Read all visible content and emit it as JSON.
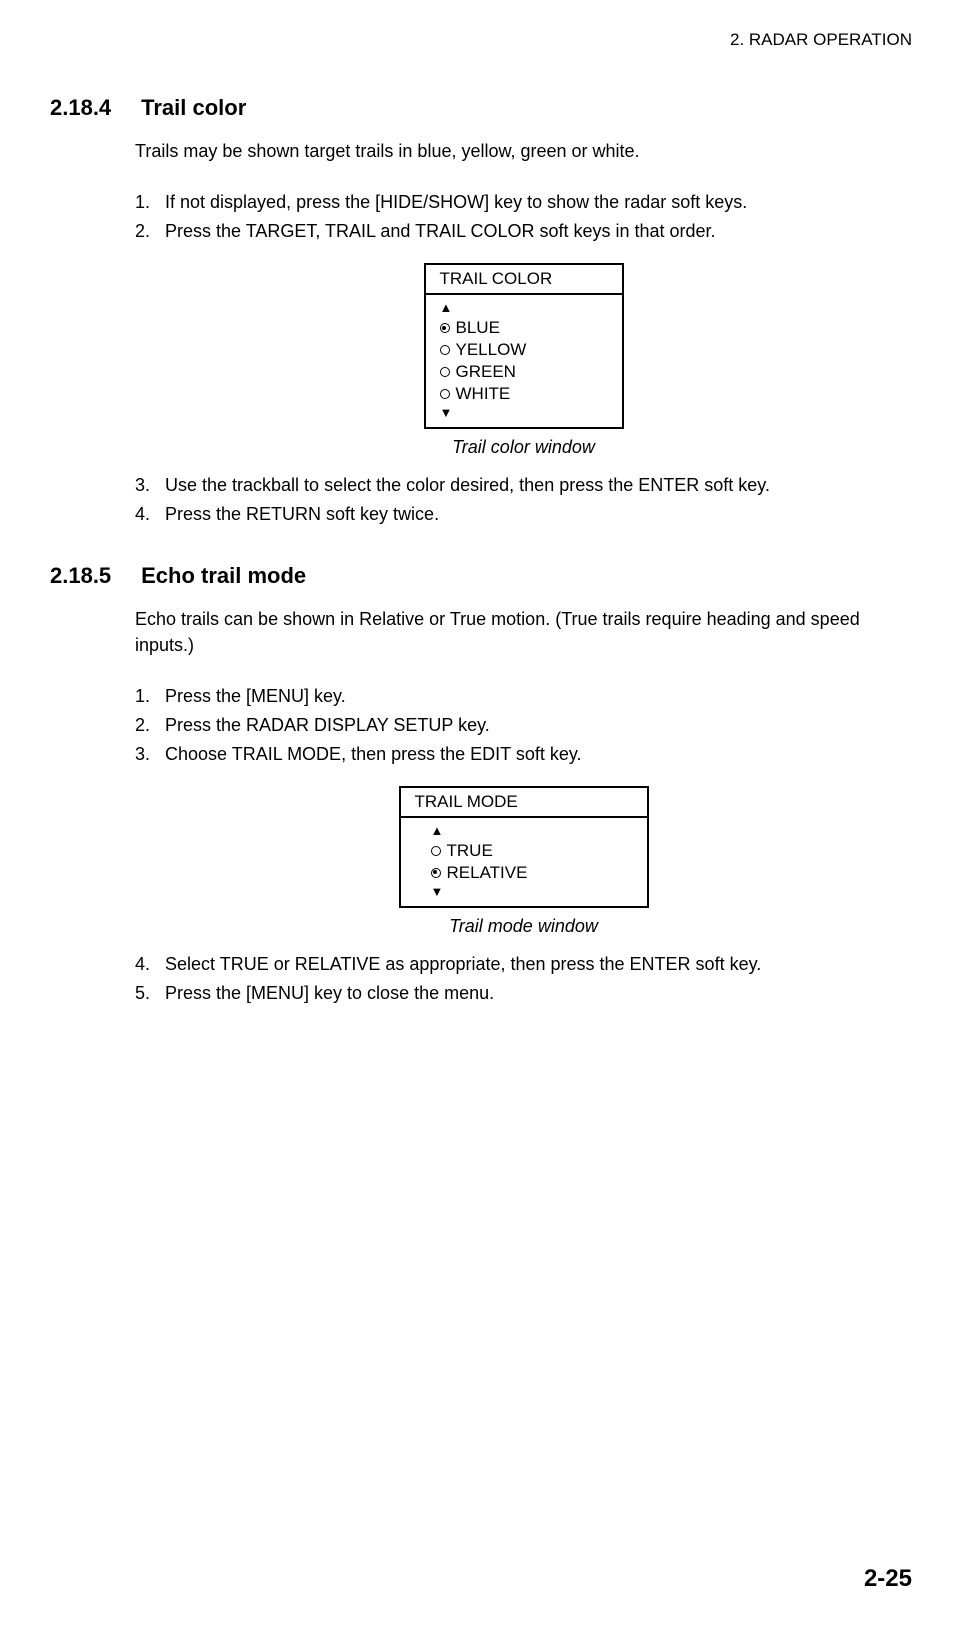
{
  "header": {
    "chapter": "2. RADAR OPERATION"
  },
  "section1": {
    "number": "2.18.4",
    "title": "Trail color",
    "intro": "Trails may be shown target trails in blue, yellow, green or white.",
    "steps_a": [
      {
        "n": "1.",
        "t": "If not displayed, press the [HIDE/SHOW] key to show the radar soft keys."
      },
      {
        "n": "2.",
        "t": "Press the TARGET, TRAIL and TRAIL COLOR soft keys in that order."
      }
    ],
    "window": {
      "title": "TRAIL COLOR",
      "options": [
        {
          "label": "BLUE",
          "selected": true
        },
        {
          "label": "YELLOW",
          "selected": false
        },
        {
          "label": "GREEN",
          "selected": false
        },
        {
          "label": "WHITE",
          "selected": false
        }
      ],
      "caption": "Trail color window"
    },
    "steps_b": [
      {
        "n": "3.",
        "t": "Use the trackball to select the color desired, then press the ENTER soft key."
      },
      {
        "n": "4.",
        "t": "Press the RETURN soft key twice."
      }
    ]
  },
  "section2": {
    "number": "2.18.5",
    "title": "Echo trail mode",
    "intro": "Echo trails can be shown in Relative or True motion. (True trails require heading and speed inputs.)",
    "steps_a": [
      {
        "n": "1.",
        "t": "Press the [MENU] key."
      },
      {
        "n": "2.",
        "t": "Press the RADAR DISPLAY SETUP key."
      },
      {
        "n": "3.",
        "t": "Choose TRAIL MODE, then press the EDIT soft key."
      }
    ],
    "window": {
      "title": "TRAIL MODE",
      "options": [
        {
          "label": "TRUE",
          "selected": false
        },
        {
          "label": "RELATIVE",
          "selected": true
        }
      ],
      "caption": "Trail mode window"
    },
    "steps_b": [
      {
        "n": "4.",
        "t": "Select TRUE or RELATIVE as appropriate, then press the ENTER soft key."
      },
      {
        "n": "5.",
        "t": "Press the [MENU] key to close the menu."
      }
    ]
  },
  "page_number": "2-25",
  "glyphs": {
    "up": "▲",
    "down": "▼"
  }
}
